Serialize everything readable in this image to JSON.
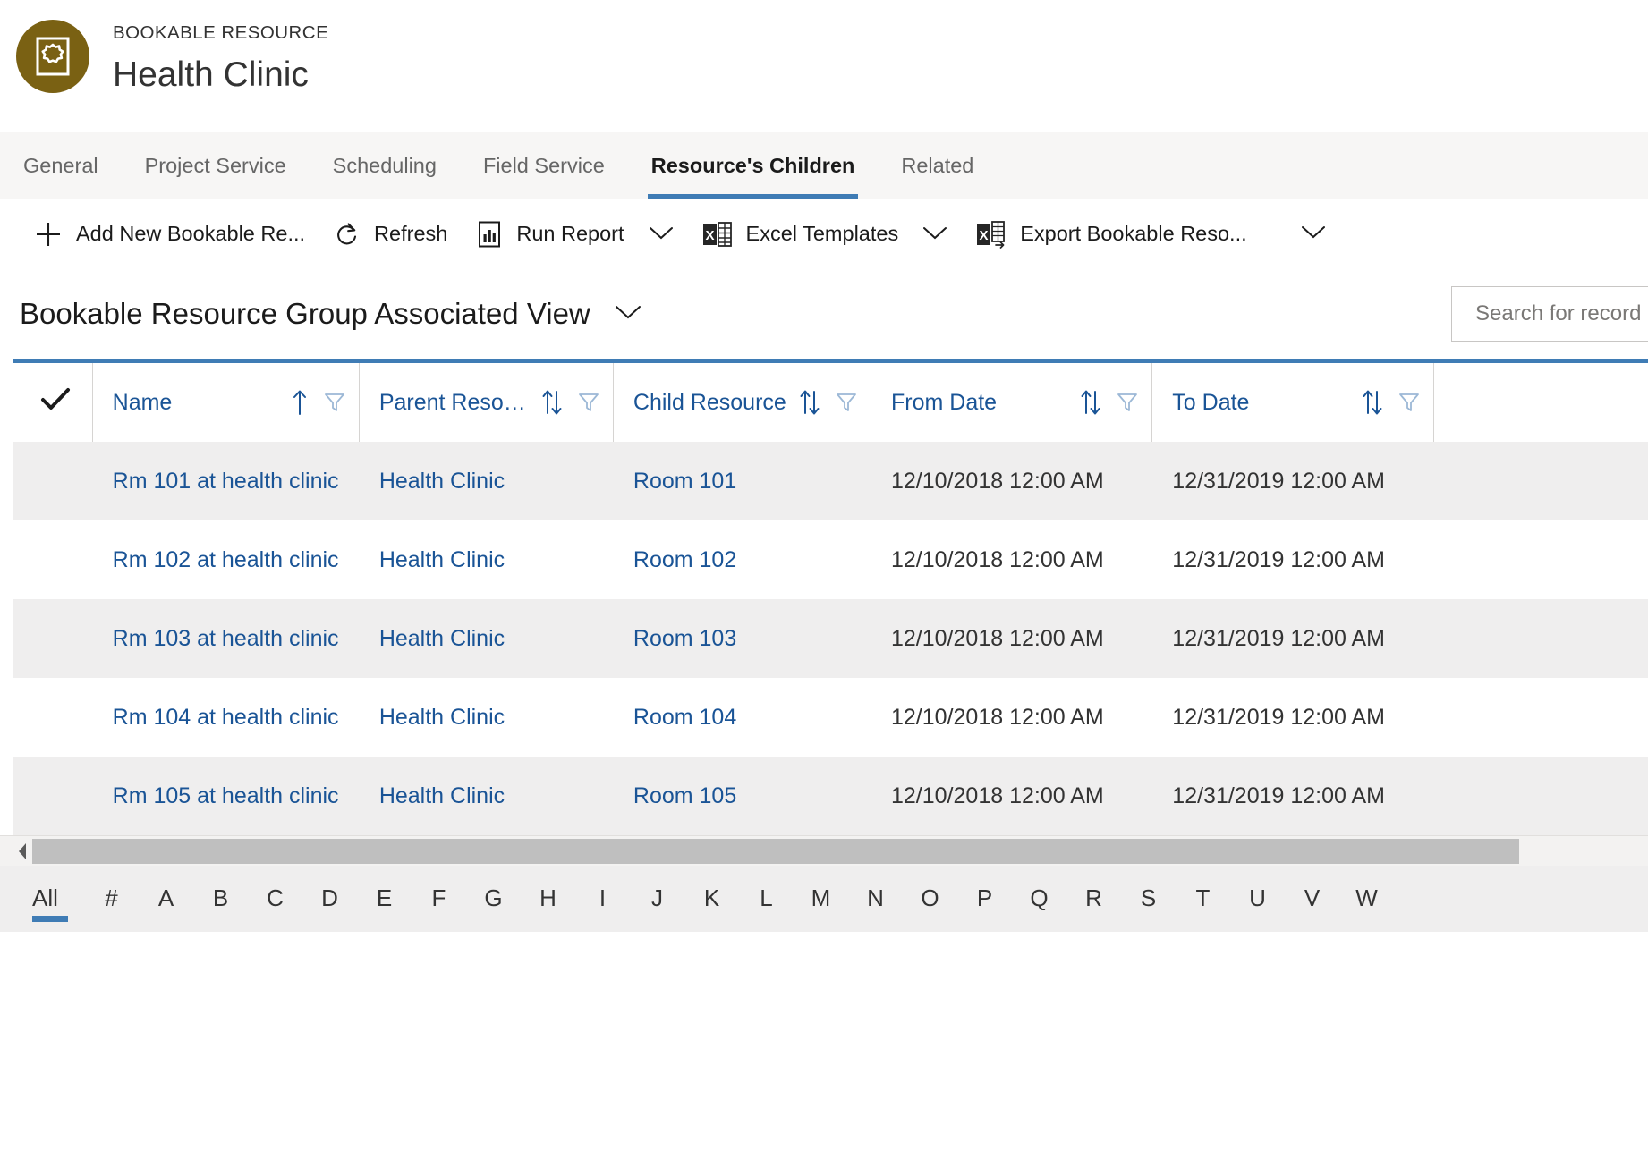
{
  "header": {
    "entity_type": "BOOKABLE RESOURCE",
    "record_title": "Health Clinic",
    "avatar_icon": "bookable-resource-icon",
    "avatar_color": "#7a6113"
  },
  "tabs": [
    {
      "label": "General",
      "active": false
    },
    {
      "label": "Project Service",
      "active": false
    },
    {
      "label": "Scheduling",
      "active": false
    },
    {
      "label": "Field Service",
      "active": false
    },
    {
      "label": "Resource's Children",
      "active": true
    },
    {
      "label": "Related",
      "active": false
    }
  ],
  "commandbar": {
    "items": [
      {
        "label": "Add New Bookable Re...",
        "icon": "plus-icon",
        "has_chevron": false
      },
      {
        "label": "Refresh",
        "icon": "refresh-icon",
        "has_chevron": false
      },
      {
        "label": "Run Report",
        "icon": "report-icon",
        "has_chevron": true
      },
      {
        "label": "Excel Templates",
        "icon": "excel-icon",
        "has_chevron": true
      },
      {
        "label": "Export Bookable Reso...",
        "icon": "excel-export-icon",
        "has_chevron": false
      }
    ],
    "overflow_icon": "chevron-down-icon"
  },
  "view": {
    "title": "Bookable Resource Group Associated View",
    "selector_icon": "chevron-down-icon"
  },
  "search": {
    "placeholder": "Search for record",
    "value": ""
  },
  "grid": {
    "accent_color": "#3f7cb5",
    "link_color": "#1a5496",
    "select_all_icon": "checkmark-icon",
    "columns": [
      {
        "label": "Name",
        "sort": "asc",
        "filter": true
      },
      {
        "label": "Parent Resour...",
        "sort": "none",
        "filter": true
      },
      {
        "label": "Child Resource",
        "sort": "none",
        "filter": true
      },
      {
        "label": "From Date",
        "sort": "none",
        "filter": true
      },
      {
        "label": "To Date",
        "sort": "none",
        "filter": true
      }
    ],
    "rows": [
      {
        "name": "Rm 101 at health clinic",
        "parent": "Health Clinic",
        "child": "Room 101",
        "from": "12/10/2018 12:00 AM",
        "to": "12/31/2019 12:00 AM"
      },
      {
        "name": "Rm 102 at health clinic",
        "parent": "Health Clinic",
        "child": "Room 102",
        "from": "12/10/2018 12:00 AM",
        "to": "12/31/2019 12:00 AM"
      },
      {
        "name": "Rm 103 at health clinic",
        "parent": "Health Clinic",
        "child": "Room 103",
        "from": "12/10/2018 12:00 AM",
        "to": "12/31/2019 12:00 AM"
      },
      {
        "name": "Rm 104 at health clinic",
        "parent": "Health Clinic",
        "child": "Room 104",
        "from": "12/10/2018 12:00 AM",
        "to": "12/31/2019 12:00 AM"
      },
      {
        "name": "Rm 105 at health clinic",
        "parent": "Health Clinic",
        "child": "Room 105",
        "from": "12/10/2018 12:00 AM",
        "to": "12/31/2019 12:00 AM"
      }
    ]
  },
  "alpha_index": {
    "selected": "All",
    "items": [
      "All",
      "#",
      "A",
      "B",
      "C",
      "D",
      "E",
      "F",
      "G",
      "H",
      "I",
      "J",
      "K",
      "L",
      "M",
      "N",
      "O",
      "P",
      "Q",
      "R",
      "S",
      "T",
      "U",
      "V",
      "W"
    ]
  }
}
